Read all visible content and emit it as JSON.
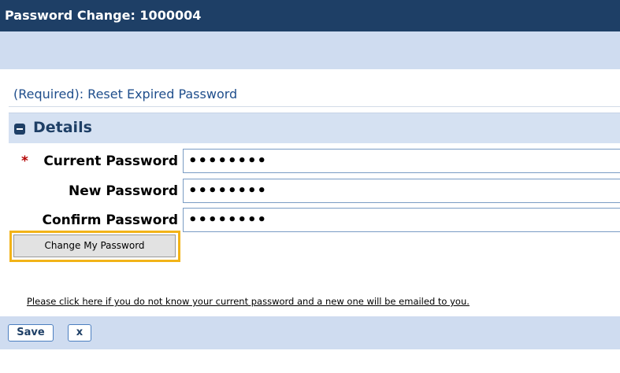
{
  "header": {
    "title": "Password Change: 1000004"
  },
  "subheading": "(Required): Reset Expired Password",
  "details": {
    "title": "Details",
    "fields": [
      {
        "required_marker": "*",
        "label": "Current Password",
        "value": "••••••••"
      },
      {
        "label": "New Password",
        "value": "••••••••"
      },
      {
        "label": "Confirm Password",
        "value": "••••••••"
      }
    ],
    "change_button": "Change My Password",
    "help_link": "Please click here if you do not know your current password and a new one will be emailed to you."
  },
  "footer": {
    "save_label": "Save",
    "close_label": "x"
  },
  "colors": {
    "title_bar": "#1e3f66",
    "section_band": "#cfdcf0",
    "highlight": "#f2b318",
    "required": "#b30000"
  },
  "icons": {
    "section_toggle": "collapse-minus-icon"
  }
}
